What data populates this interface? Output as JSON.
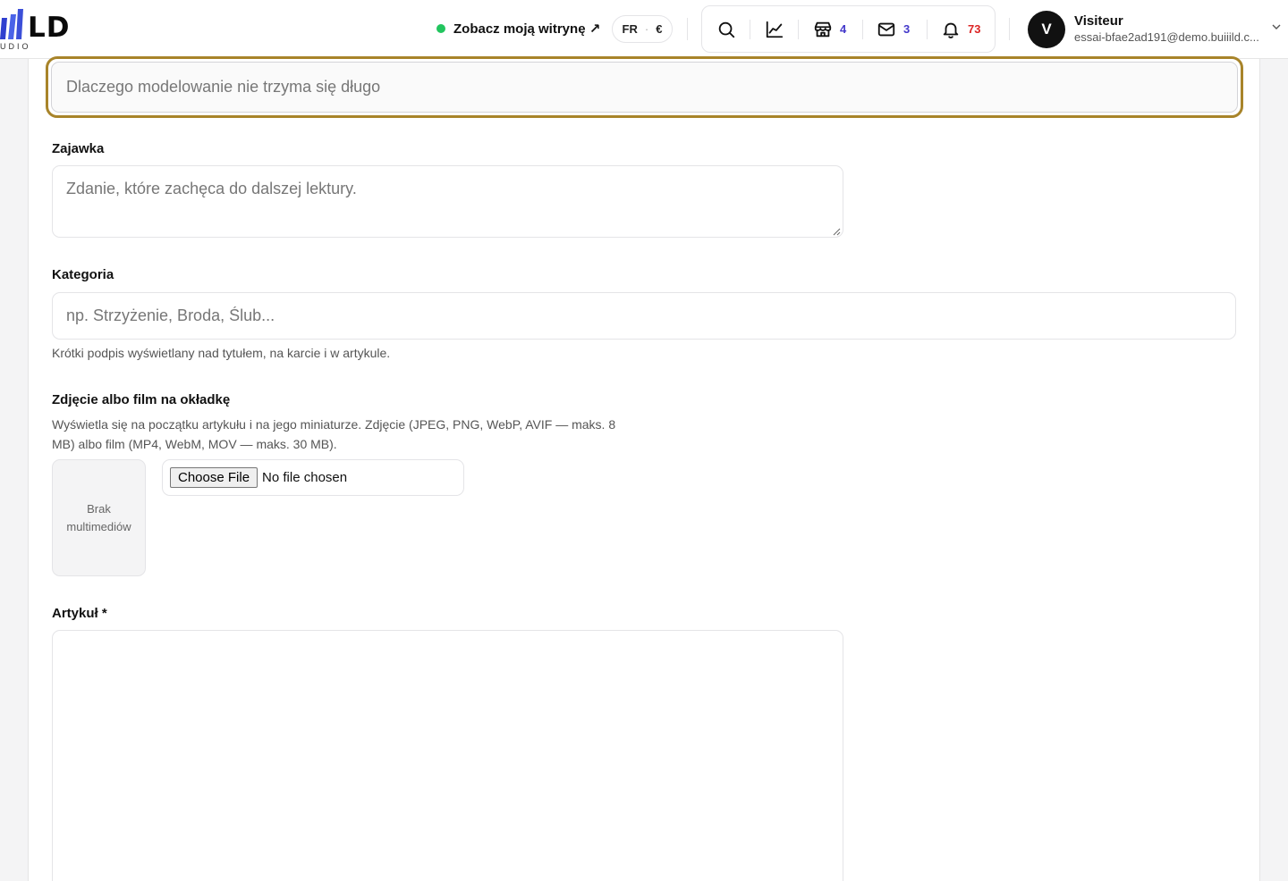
{
  "header": {
    "logo_text": "LD",
    "logo_sub": "UDIO",
    "site_link_label": "Zobacz moją witrynę ↗",
    "locale_lang": "FR",
    "locale_currency": "€",
    "store_count": "4",
    "mail_count": "3",
    "notif_count": "73",
    "user_initial": "V",
    "user_name": "Visiteur",
    "user_email": "essai-bfae2ad191@demo.buiiild.c...",
    "colors": {
      "online_dot": "#22c55e",
      "badge_blue": "#4338ca",
      "badge_red": "#dc2626",
      "focus_ring": "#a8842a"
    },
    "icons": [
      "search-icon",
      "chart-icon",
      "store-icon",
      "mail-icon",
      "bell-icon",
      "chevron-down-icon"
    ]
  },
  "form": {
    "title": {
      "placeholder": "Dlaczego modelowanie nie trzyma się długo"
    },
    "teaser": {
      "label": "Zajawka",
      "placeholder": "Zdanie, które zachęca do dalszej lektury."
    },
    "category": {
      "label": "Kategoria",
      "placeholder": "np. Strzyżenie, Broda, Ślub...",
      "help": "Krótki podpis wyświetlany nad tytułem, na karcie i w artykule."
    },
    "cover": {
      "label": "Zdjęcie albo film na okładkę",
      "help_line1": "Wyświetla się na początku artykułu i na jego miniaturze. Zdjęcie (JPEG, PNG, WebP, AVIF — maks. 8",
      "help_line2": "MB) albo film (MP4, WebM, MOV — maks. 30 MB).",
      "empty_line1": "Brak",
      "empty_line2": "multimediów",
      "choose_file": "Choose File",
      "file_status": "No file chosen"
    },
    "article": {
      "label": "Artykuł *"
    }
  }
}
